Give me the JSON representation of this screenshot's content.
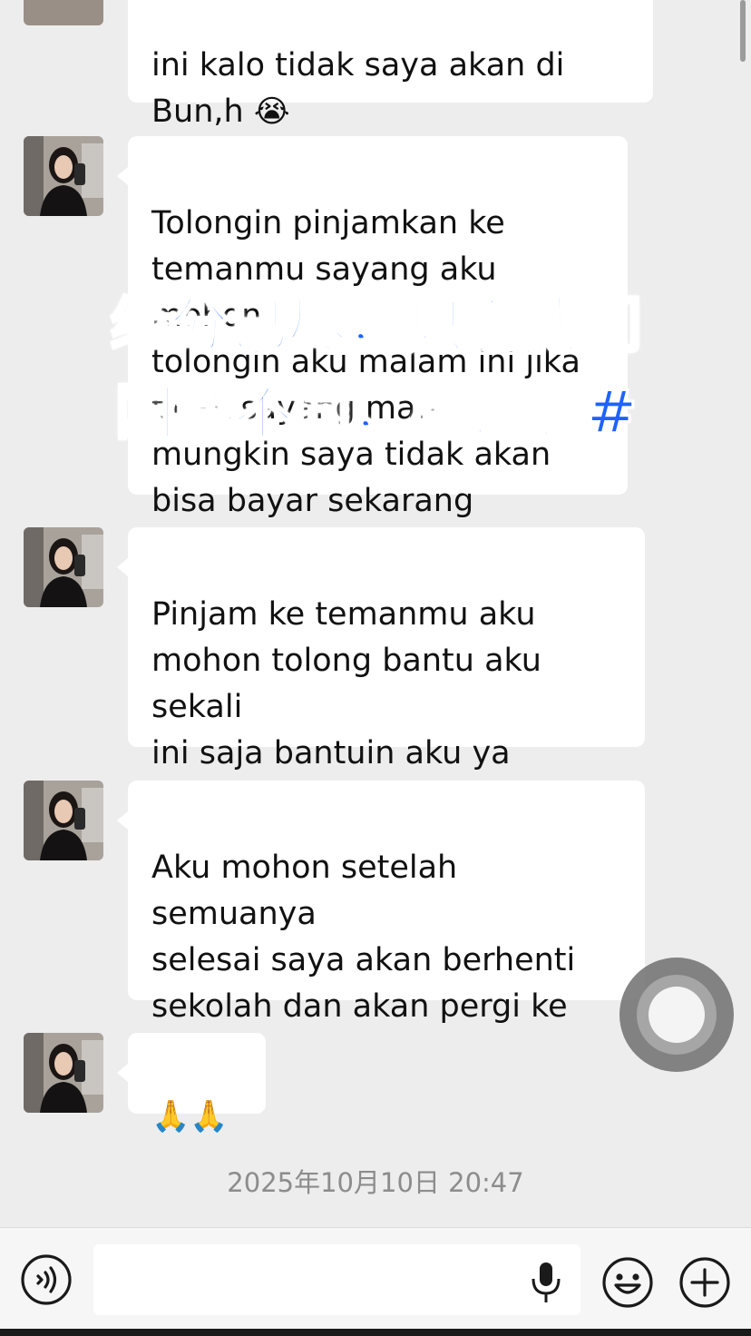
{
  "messages": [
    {
      "text": "ini kalo tidak saya akan di\nBun,h ",
      "emoji": "😭"
    },
    {
      "text": "Tolongin pinjamkan ke\ntemanmu sayang aku mohon\ntolongin aku malam ini jika\ntidak sayang mati\nmungkin saya tidak akan\nbisa bayar sekarang\n",
      "emoji": "😭🥺😓"
    },
    {
      "text": "Pinjam ke temanmu aku\nmohon tolong bantu aku sekali\nini saja bantuin aku ya\nmenyangkut hidup dan mati",
      "emoji": ""
    },
    {
      "text": "Aku mohon setelah semuanya\nselesai saya akan berhenti\nsekolah dan akan pergi ke\nchina",
      "emoji": ""
    },
    {
      "text": "",
      "emoji": "🙏🙏"
    }
  ],
  "timestamp": "2025年10月10日 20:47",
  "overlay": {
    "line1": "缘分已尽，只怪我们",
    "line2": "国籍不同，感谢您#"
  },
  "icons": {
    "voice": "voice-message-icon",
    "microphone": "microphone-icon",
    "emoji": "emoji-icon",
    "more": "plus-icon"
  },
  "colors": {
    "background": "#ededed",
    "bubble": "#ffffff",
    "overlay_text": "#1e63ff"
  }
}
